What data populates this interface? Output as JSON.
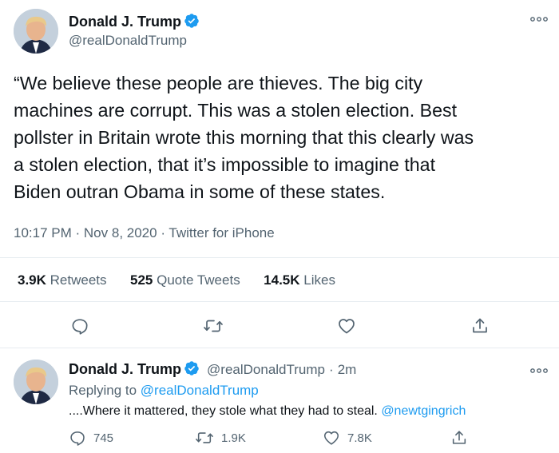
{
  "main_tweet": {
    "author_name": "Donald J. Trump",
    "author_handle": "@realDonaldTrump",
    "more_icon": "more-dots-icon",
    "text_lines": [
      "“We believe these people are thieves. The big city",
      "machines are corrupt. This was a stolen election. Best",
      "pollster in Britain wrote this morning that this clearly was",
      "a stolen election, that it’s impossible to imagine that",
      "Biden outran Obama in some of these states."
    ],
    "time": "10:17 PM",
    "date": "Nov 8, 2020",
    "source": "Twitter for iPhone",
    "separator": "·",
    "stats": {
      "retweets_count": "3.9K",
      "retweets_label": "Retweets",
      "quotes_count": "525",
      "quotes_label": "Quote Tweets",
      "likes_count": "14.5K",
      "likes_label": "Likes"
    }
  },
  "reply_tweet": {
    "author_name": "Donald J. Trump",
    "author_handle": "@realDonaldTrump",
    "age": "2m",
    "separator": "·",
    "replying_prefix": "Replying to",
    "replying_handle": "@realDonaldTrump",
    "text": "....Where it mattered, they stole what they had to steal.",
    "mention": "@newtgingrich",
    "reply_count": "745",
    "retweet_count": "1.9K",
    "like_count": "7.8K"
  },
  "colors": {
    "accent": "#1d9bf0",
    "text": "#0f1419",
    "secondary": "#536471",
    "divider": "#e6ecf0"
  }
}
